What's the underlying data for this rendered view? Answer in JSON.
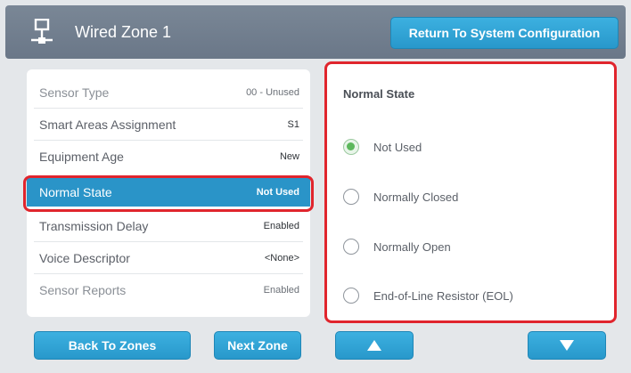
{
  "header": {
    "icon": "network-zone-icon",
    "title": "Wired Zone 1",
    "return_label": "Return To System Configuration"
  },
  "settings": {
    "rows": [
      {
        "label": "Sensor Type",
        "value": "00 - Unused",
        "state": "dim"
      },
      {
        "label": "Smart Areas Assignment",
        "value": "S1",
        "state": "normal"
      },
      {
        "label": "Equipment Age",
        "value": "New",
        "state": "normal"
      },
      {
        "label": "Normal State",
        "value": "Not Used",
        "state": "selected"
      },
      {
        "label": "Transmission Delay",
        "value": "Enabled",
        "state": "normal"
      },
      {
        "label": "Voice Descriptor",
        "value": "<None>",
        "state": "normal"
      },
      {
        "label": "Sensor Reports",
        "value": "Enabled",
        "state": "dim"
      }
    ]
  },
  "options": {
    "title": "Normal State",
    "items": [
      {
        "label": "Not Used",
        "checked": true
      },
      {
        "label": "Normally Closed",
        "checked": false
      },
      {
        "label": "Normally Open",
        "checked": false
      },
      {
        "label": "End-of-Line Resistor (EOL)",
        "checked": false
      }
    ]
  },
  "footer": {
    "back_label": "Back To Zones",
    "next_label": "Next Zone",
    "up_icon": "arrow-up-icon",
    "down_icon": "arrow-down-icon"
  },
  "colors": {
    "header_bg": "#6f7c8c",
    "accent_blue": "#2a94c8",
    "highlight_red": "#e0252d",
    "radio_green": "#5cb85c"
  }
}
